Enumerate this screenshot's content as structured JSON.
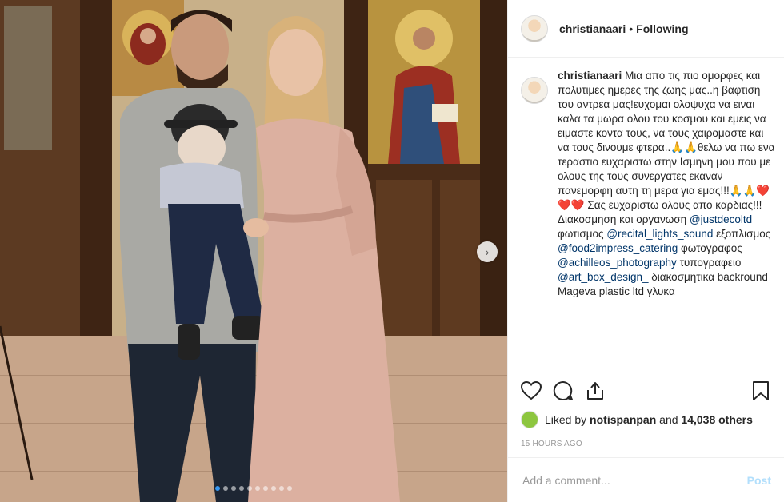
{
  "post": {
    "username": "christianaari",
    "separator": "•",
    "follow_status": "Following",
    "caption_parts": [
      {
        "type": "text",
        "text": "Μια απο τις πιο ομορφες και πολυτιμες ημερες της ζωης μας..η βαφτιση του αντρεα μας!ευχομαι ολοψυχα να ειναι καλα τα μωρα ολου του κοσμου και εμεις να ειμαστε κοντα τους, να τους χαιρομαστε και να τους δινουμε φτερα..🙏🙏θελω να πω ενα τεραστιο ευχαριστω στην Ισμηνη μου που με ολους της τους συνεργατες εκαναν πανεμορφη αυτη τη μερα για εμας!!!🙏🙏❤️❤️❤️ Σας ευχαριστω ολους απο καρδιας!!! Διακοσμηση και οργανωση "
      },
      {
        "type": "mention",
        "text": "@justdecoltd"
      },
      {
        "type": "text",
        "text": " φωτισμος "
      },
      {
        "type": "mention",
        "text": "@recital_lights_sound"
      },
      {
        "type": "text",
        "text": " εξοπλισμος "
      },
      {
        "type": "mention",
        "text": "@food2impress_catering"
      },
      {
        "type": "text",
        "text": " φωτογραφος "
      },
      {
        "type": "mention",
        "text": "@achilleos_photography"
      },
      {
        "type": "text",
        "text": " τυπογραφειο "
      },
      {
        "type": "mention",
        "text": "@art_box_design_"
      },
      {
        "type": "text",
        "text": " διακοσμητικα backround Mageva plastic ltd γλυκα"
      }
    ],
    "likes": {
      "liker": "notispanpan",
      "and_text": "and",
      "count_text": "14,038 others",
      "prefix": "Liked by"
    },
    "timestamp": "15 HOURS AGO",
    "comment_placeholder": "Add a comment...",
    "post_button": "Post"
  },
  "carousel": {
    "total": 10,
    "active_index": 0
  },
  "colors": {
    "accent": "#3897f0",
    "mention": "#003569",
    "post_disabled": "#b2dffc"
  },
  "icons": [
    "heart-icon",
    "comment-icon",
    "share-icon",
    "bookmark-icon",
    "chevron-right-icon"
  ]
}
